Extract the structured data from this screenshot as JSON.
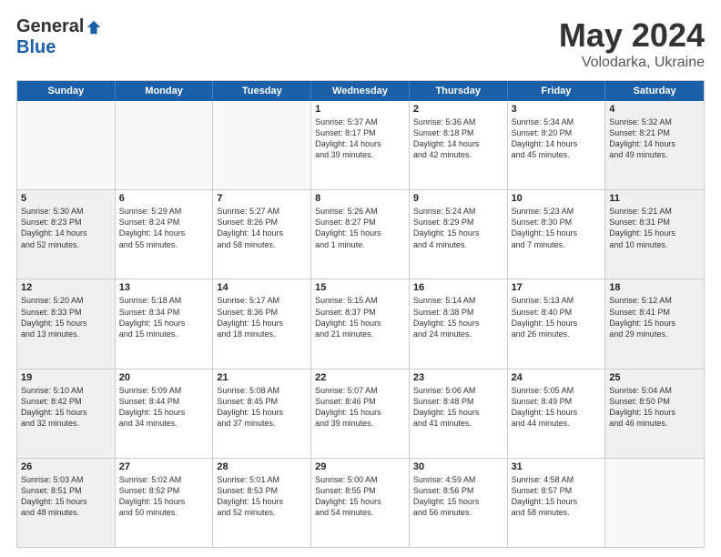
{
  "logo": {
    "general": "General",
    "blue": "Blue"
  },
  "title": {
    "month": "May 2024",
    "location": "Volodarka, Ukraine"
  },
  "weekdays": [
    "Sunday",
    "Monday",
    "Tuesday",
    "Wednesday",
    "Thursday",
    "Friday",
    "Saturday"
  ],
  "rows": [
    [
      {
        "day": "",
        "info": "",
        "empty": true
      },
      {
        "day": "",
        "info": "",
        "empty": true
      },
      {
        "day": "",
        "info": "",
        "empty": true
      },
      {
        "day": "1",
        "info": "Sunrise: 5:37 AM\nSunset: 8:17 PM\nDaylight: 14 hours\nand 39 minutes."
      },
      {
        "day": "2",
        "info": "Sunrise: 5:36 AM\nSunset: 8:18 PM\nDaylight: 14 hours\nand 42 minutes."
      },
      {
        "day": "3",
        "info": "Sunrise: 5:34 AM\nSunset: 8:20 PM\nDaylight: 14 hours\nand 45 minutes."
      },
      {
        "day": "4",
        "info": "Sunrise: 5:32 AM\nSunset: 8:21 PM\nDaylight: 14 hours\nand 49 minutes.",
        "shaded": true
      }
    ],
    [
      {
        "day": "5",
        "info": "Sunrise: 5:30 AM\nSunset: 8:23 PM\nDaylight: 14 hours\nand 52 minutes.",
        "shaded": true
      },
      {
        "day": "6",
        "info": "Sunrise: 5:29 AM\nSunset: 8:24 PM\nDaylight: 14 hours\nand 55 minutes."
      },
      {
        "day": "7",
        "info": "Sunrise: 5:27 AM\nSunset: 8:26 PM\nDaylight: 14 hours\nand 58 minutes."
      },
      {
        "day": "8",
        "info": "Sunrise: 5:26 AM\nSunset: 8:27 PM\nDaylight: 15 hours\nand 1 minute."
      },
      {
        "day": "9",
        "info": "Sunrise: 5:24 AM\nSunset: 8:29 PM\nDaylight: 15 hours\nand 4 minutes."
      },
      {
        "day": "10",
        "info": "Sunrise: 5:23 AM\nSunset: 8:30 PM\nDaylight: 15 hours\nand 7 minutes."
      },
      {
        "day": "11",
        "info": "Sunrise: 5:21 AM\nSunset: 8:31 PM\nDaylight: 15 hours\nand 10 minutes.",
        "shaded": true
      }
    ],
    [
      {
        "day": "12",
        "info": "Sunrise: 5:20 AM\nSunset: 8:33 PM\nDaylight: 15 hours\nand 13 minutes.",
        "shaded": true
      },
      {
        "day": "13",
        "info": "Sunrise: 5:18 AM\nSunset: 8:34 PM\nDaylight: 15 hours\nand 15 minutes."
      },
      {
        "day": "14",
        "info": "Sunrise: 5:17 AM\nSunset: 8:36 PM\nDaylight: 15 hours\nand 18 minutes."
      },
      {
        "day": "15",
        "info": "Sunrise: 5:15 AM\nSunset: 8:37 PM\nDaylight: 15 hours\nand 21 minutes."
      },
      {
        "day": "16",
        "info": "Sunrise: 5:14 AM\nSunset: 8:38 PM\nDaylight: 15 hours\nand 24 minutes."
      },
      {
        "day": "17",
        "info": "Sunrise: 5:13 AM\nSunset: 8:40 PM\nDaylight: 15 hours\nand 26 minutes."
      },
      {
        "day": "18",
        "info": "Sunrise: 5:12 AM\nSunset: 8:41 PM\nDaylight: 15 hours\nand 29 minutes.",
        "shaded": true
      }
    ],
    [
      {
        "day": "19",
        "info": "Sunrise: 5:10 AM\nSunset: 8:42 PM\nDaylight: 15 hours\nand 32 minutes.",
        "shaded": true
      },
      {
        "day": "20",
        "info": "Sunrise: 5:09 AM\nSunset: 8:44 PM\nDaylight: 15 hours\nand 34 minutes."
      },
      {
        "day": "21",
        "info": "Sunrise: 5:08 AM\nSunset: 8:45 PM\nDaylight: 15 hours\nand 37 minutes."
      },
      {
        "day": "22",
        "info": "Sunrise: 5:07 AM\nSunset: 8:46 PM\nDaylight: 15 hours\nand 39 minutes."
      },
      {
        "day": "23",
        "info": "Sunrise: 5:06 AM\nSunset: 8:48 PM\nDaylight: 15 hours\nand 41 minutes."
      },
      {
        "day": "24",
        "info": "Sunrise: 5:05 AM\nSunset: 8:49 PM\nDaylight: 15 hours\nand 44 minutes."
      },
      {
        "day": "25",
        "info": "Sunrise: 5:04 AM\nSunset: 8:50 PM\nDaylight: 15 hours\nand 46 minutes.",
        "shaded": true
      }
    ],
    [
      {
        "day": "26",
        "info": "Sunrise: 5:03 AM\nSunset: 8:51 PM\nDaylight: 15 hours\nand 48 minutes.",
        "shaded": true
      },
      {
        "day": "27",
        "info": "Sunrise: 5:02 AM\nSunset: 8:52 PM\nDaylight: 15 hours\nand 50 minutes."
      },
      {
        "day": "28",
        "info": "Sunrise: 5:01 AM\nSunset: 8:53 PM\nDaylight: 15 hours\nand 52 minutes."
      },
      {
        "day": "29",
        "info": "Sunrise: 5:00 AM\nSunset: 8:55 PM\nDaylight: 15 hours\nand 54 minutes."
      },
      {
        "day": "30",
        "info": "Sunrise: 4:59 AM\nSunset: 8:56 PM\nDaylight: 15 hours\nand 56 minutes."
      },
      {
        "day": "31",
        "info": "Sunrise: 4:58 AM\nSunset: 8:57 PM\nDaylight: 15 hours\nand 58 minutes."
      },
      {
        "day": "",
        "info": "",
        "empty": true
      }
    ]
  ]
}
